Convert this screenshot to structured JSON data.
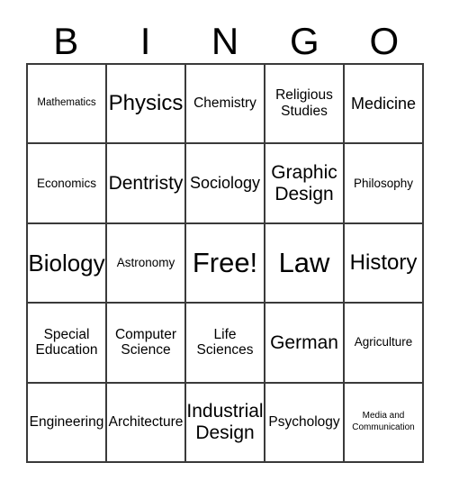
{
  "card": {
    "header_letters": [
      "B",
      "I",
      "N",
      "G",
      "O"
    ],
    "columns": 5,
    "rows": 5,
    "free_space": {
      "row": 2,
      "col": 2,
      "label": "Free!"
    },
    "colors": {
      "background": "#ffffff",
      "text": "#000000",
      "grid_line": "#3a3a3a"
    },
    "cells": [
      {
        "label": "Mathematics",
        "size": "fs-xs",
        "row": 0,
        "col": 0
      },
      {
        "label": "Physics",
        "size": "fs-2xl",
        "row": 0,
        "col": 1
      },
      {
        "label": "Chemistry",
        "size": "fs-md",
        "row": 0,
        "col": 2
      },
      {
        "label": "Religious\nStudies",
        "size": "fs-md",
        "row": 0,
        "col": 3
      },
      {
        "label": "Medicine",
        "size": "fs-lg",
        "row": 0,
        "col": 4
      },
      {
        "label": "Economics",
        "size": "fs-sm",
        "row": 1,
        "col": 0
      },
      {
        "label": "Dentristy",
        "size": "fs-xl",
        "row": 1,
        "col": 1
      },
      {
        "label": "Sociology",
        "size": "fs-lg",
        "row": 1,
        "col": 2
      },
      {
        "label": "Graphic\nDesign",
        "size": "fs-xl",
        "row": 1,
        "col": 3
      },
      {
        "label": "Philosophy",
        "size": "fs-sm",
        "row": 1,
        "col": 4
      },
      {
        "label": "Biology",
        "size": "fs-3xl",
        "row": 2,
        "col": 0
      },
      {
        "label": "Astronomy",
        "size": "fs-sm",
        "row": 2,
        "col": 1
      },
      {
        "label": "Free!",
        "size": "fs-4xl",
        "row": 2,
        "col": 2
      },
      {
        "label": "Law",
        "size": "fs-4xl",
        "row": 2,
        "col": 3
      },
      {
        "label": "History",
        "size": "fs-2xl",
        "row": 2,
        "col": 4
      },
      {
        "label": "Special\nEducation",
        "size": "fs-md",
        "row": 3,
        "col": 0
      },
      {
        "label": "Computer\nScience",
        "size": "fs-md",
        "row": 3,
        "col": 1
      },
      {
        "label": "Life\nSciences",
        "size": "fs-md",
        "row": 3,
        "col": 2
      },
      {
        "label": "German",
        "size": "fs-xl",
        "row": 3,
        "col": 3
      },
      {
        "label": "Agriculture",
        "size": "fs-sm",
        "row": 3,
        "col": 4
      },
      {
        "label": "Engineering",
        "size": "fs-md",
        "row": 4,
        "col": 0
      },
      {
        "label": "Architecture",
        "size": "fs-md",
        "row": 4,
        "col": 1
      },
      {
        "label": "Industrial\nDesign",
        "size": "fs-xl",
        "row": 4,
        "col": 2
      },
      {
        "label": "Psychology",
        "size": "fs-md",
        "row": 4,
        "col": 3
      },
      {
        "label": "Media and\nCommunication",
        "size": "fs-xxs",
        "row": 4,
        "col": 4
      }
    ]
  }
}
